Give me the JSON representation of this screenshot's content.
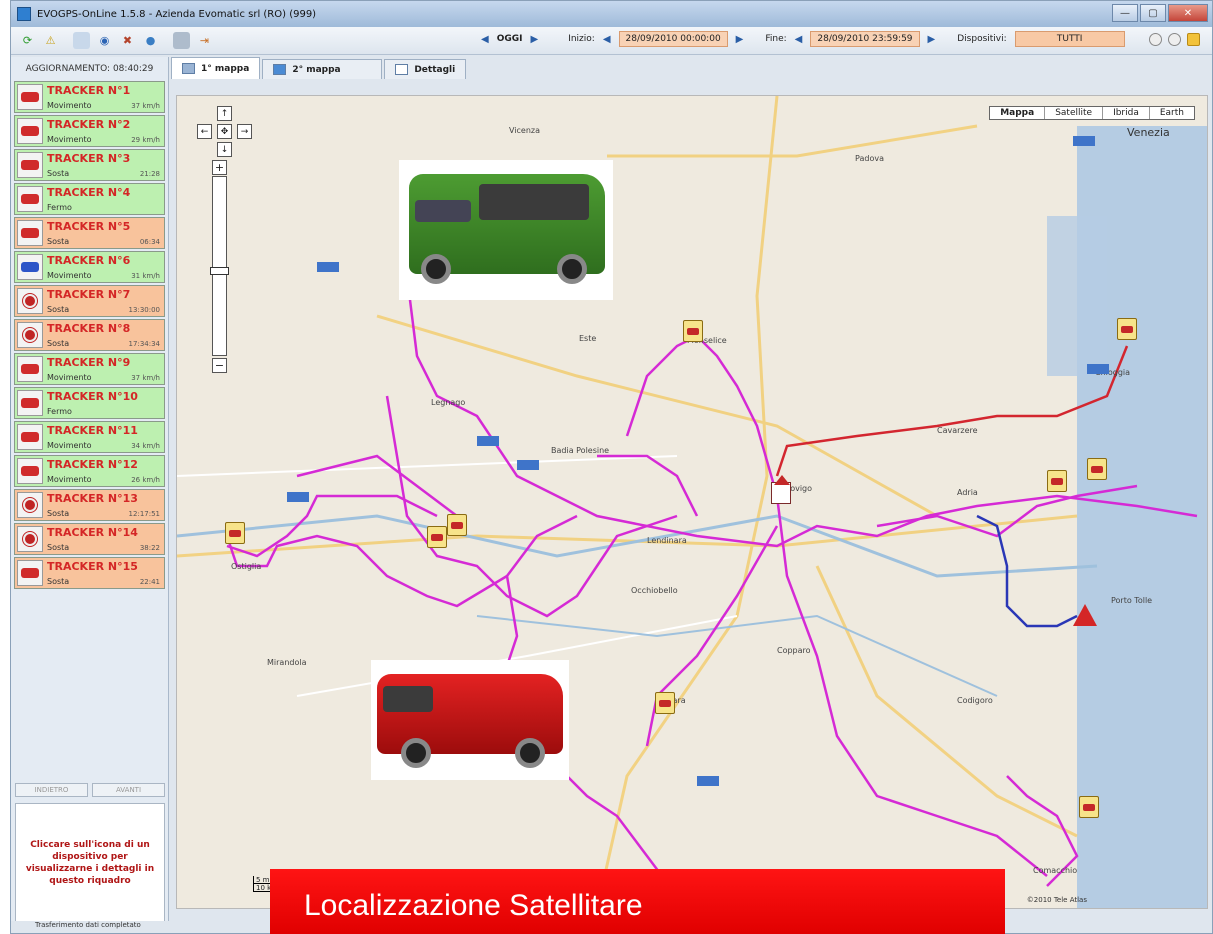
{
  "window": {
    "title": "EVOGPS-OnLine 1.5.8 - Azienda Evomatic srl (RO) (999)"
  },
  "toolbar": {
    "today_label": "OGGI",
    "start_label": "Inizio:",
    "start_value": "28/09/2010 00:00:00",
    "end_label": "Fine:",
    "end_value": "28/09/2010 23:59:59",
    "devices_label": "Dispositivi:",
    "devices_value": "TUTTI"
  },
  "sidebar": {
    "update_label": "AGGIORNAMENTO: 08:40:29",
    "trackers": [
      {
        "name": "TRACKER N°1",
        "status": "Movimento",
        "speed": "37 km/h",
        "color": "green",
        "icon": "car"
      },
      {
        "name": "TRACKER N°2",
        "status": "Movimento",
        "speed": "29 km/h",
        "color": "green",
        "icon": "car"
      },
      {
        "name": "TRACKER N°3",
        "status": "Sosta",
        "speed": "21:28",
        "color": "green",
        "icon": "car"
      },
      {
        "name": "TRACKER N°4",
        "status": "Fermo",
        "speed": "",
        "color": "green",
        "icon": "car"
      },
      {
        "name": "TRACKER N°5",
        "status": "Sosta",
        "speed": "06:34",
        "color": "orange",
        "icon": "car"
      },
      {
        "name": "TRACKER N°6",
        "status": "Movimento",
        "speed": "31 km/h",
        "color": "green",
        "icon": "car-blue"
      },
      {
        "name": "TRACKER N°7",
        "status": "Sosta",
        "speed": "13:30:00",
        "color": "orange",
        "icon": "round"
      },
      {
        "name": "TRACKER N°8",
        "status": "Sosta",
        "speed": "17:34:34",
        "color": "orange",
        "icon": "round"
      },
      {
        "name": "TRACKER N°9",
        "status": "Movimento",
        "speed": "37 km/h",
        "color": "green",
        "icon": "car"
      },
      {
        "name": "TRACKER N°10",
        "status": "Fermo",
        "speed": "",
        "color": "green",
        "icon": "car"
      },
      {
        "name": "TRACKER N°11",
        "status": "Movimento",
        "speed": "34 km/h",
        "color": "green",
        "icon": "car"
      },
      {
        "name": "TRACKER N°12",
        "status": "Movimento",
        "speed": "26 km/h",
        "color": "green",
        "icon": "car"
      },
      {
        "name": "TRACKER N°13",
        "status": "Sosta",
        "speed": "12:17:51",
        "color": "orange",
        "icon": "round"
      },
      {
        "name": "TRACKER N°14",
        "status": "Sosta",
        "speed": "38:22",
        "color": "orange",
        "icon": "round"
      },
      {
        "name": "TRACKER N°15",
        "status": "Sosta",
        "speed": "22:41",
        "color": "orange",
        "icon": "car"
      }
    ],
    "prev_label": "INDIETRO",
    "next_label": "AVANTI",
    "info_text": "Cliccare sull'icona di un dispositivo per visualizzarne i dettagli in questo riquadro"
  },
  "tabs": [
    {
      "label": "1° mappa"
    },
    {
      "label": "2° mappa"
    },
    {
      "label": "Dettagli"
    }
  ],
  "map": {
    "types": [
      "Mappa",
      "Satellite",
      "Ibrida",
      "Earth"
    ],
    "scale_top": "5 mi",
    "scale_bottom": "10 km",
    "copyright": "©2010 Tele Atlas",
    "cities": [
      {
        "name": "Venezia",
        "big": true
      },
      {
        "name": "Padova",
        "big": false
      },
      {
        "name": "Vicenza",
        "big": false
      },
      {
        "name": "Chioggia",
        "big": false
      },
      {
        "name": "Rovigo",
        "big": false
      },
      {
        "name": "Adria",
        "big": false
      },
      {
        "name": "Porto Tolle",
        "big": false
      },
      {
        "name": "Ferrara",
        "big": false
      },
      {
        "name": "Lendinara",
        "big": false
      },
      {
        "name": "Legnago",
        "big": false
      },
      {
        "name": "Este",
        "big": false
      },
      {
        "name": "Monselice",
        "big": false
      },
      {
        "name": "Cavarzere",
        "big": false
      },
      {
        "name": "Codigoro",
        "big": false
      },
      {
        "name": "Comacchio",
        "big": false
      },
      {
        "name": "Ostiglia",
        "big": false
      },
      {
        "name": "Badia Polesine",
        "big": false
      },
      {
        "name": "Occhiobello",
        "big": false
      },
      {
        "name": "Copparo",
        "big": false
      },
      {
        "name": "Mirandola",
        "big": false
      }
    ]
  },
  "banner": {
    "text": "Localizzazione Satellitare"
  },
  "status": {
    "text": "Trasferimento dati completato"
  }
}
